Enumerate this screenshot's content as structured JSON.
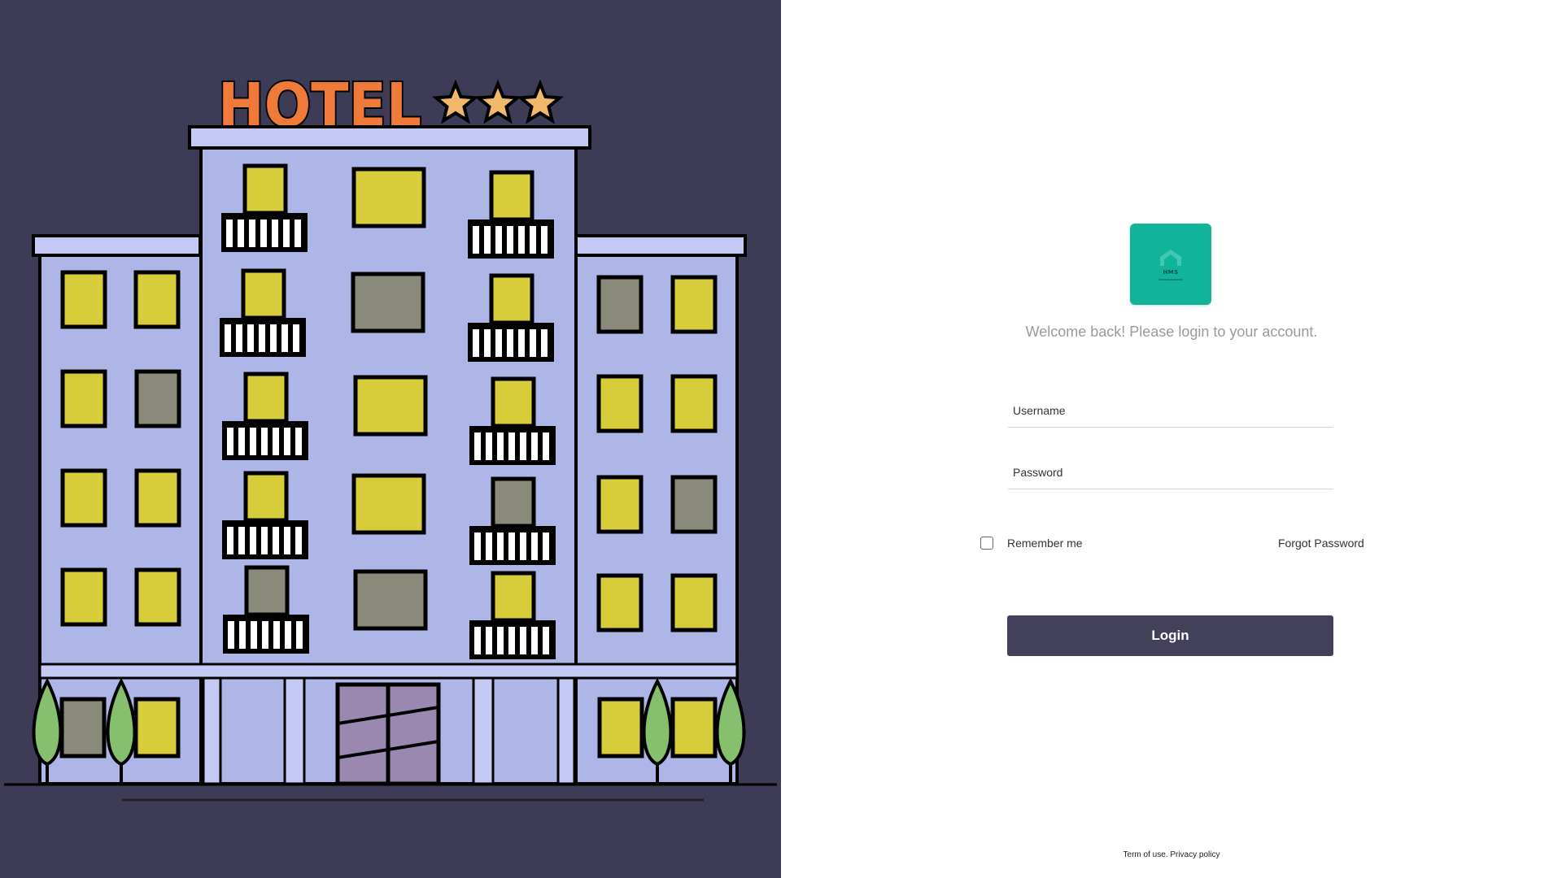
{
  "illustration": {
    "sign_text": "HOTEL",
    "star_count": 3,
    "colors": {
      "background": "#3d3b55",
      "building": "#aeb6e8",
      "window_lit": "#d7cd3b",
      "window_dark": "#8a8a7a",
      "sign": "#f07a3a",
      "star": "#f2b86a",
      "tree": "#86c06e",
      "door": "#9b88b0"
    }
  },
  "logo": {
    "icon": "house-logo-icon",
    "text": "HMS",
    "color": "#12b39b"
  },
  "welcome_text": "Welcome back! Please login to your account.",
  "form": {
    "username_placeholder": "Username",
    "username_value": "",
    "password_placeholder": "Password",
    "password_value": "",
    "remember_label": "Remember me",
    "remember_checked": false,
    "forgot_label": "Forgot Password",
    "login_label": "Login",
    "login_color": "#43405b"
  },
  "footer": {
    "terms": "Term of use.",
    "privacy": "Privacy policy"
  }
}
